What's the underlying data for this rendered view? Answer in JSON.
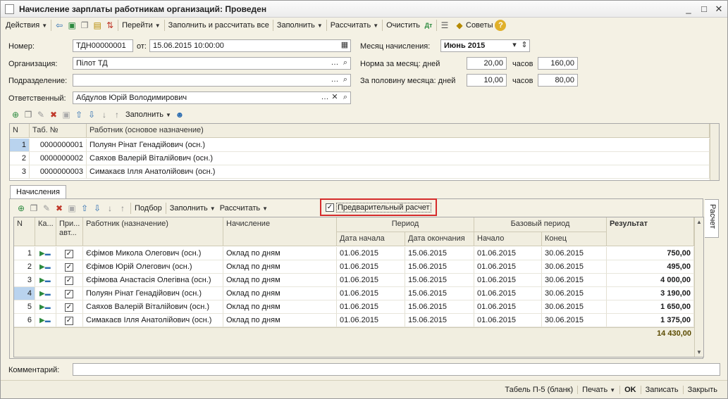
{
  "window": {
    "title": "Начисление зарплаты работникам организаций: Проведен"
  },
  "toolbar": {
    "actions": "Действия",
    "goto": "Перейти",
    "fill_calc_all": "Заполнить и рассчитать все",
    "fill": "Заполнить",
    "calculate": "Рассчитать",
    "clear": "Очистить",
    "tips": "Советы"
  },
  "form": {
    "number_label": "Номер:",
    "number_value": "ТДН00000001",
    "from_label": "от:",
    "date_value": "15.06.2015 10:00:00",
    "org_label": "Организация:",
    "org_value": "Пілот ТД",
    "dept_label": "Подразделение:",
    "dept_value": "",
    "resp_label": "Ответственный:",
    "resp_value": "Абдулов Юрій Володимирович",
    "month_label": "Месяц начисления:",
    "month_value": "Июнь 2015",
    "norm_label": "Норма за месяц: дней",
    "norm_days": "20,00",
    "hours_label": "часов",
    "norm_hours": "160,00",
    "half_label": "За половину месяца: дней",
    "half_days": "10,00",
    "half_hours": "80,00"
  },
  "workers_toolbar": {
    "fill": "Заполнить"
  },
  "workers_table": {
    "headers": [
      "N",
      "Таб. №",
      "Работник (основое назначение)"
    ],
    "rows": [
      {
        "n": "1",
        "tab": "0000000001",
        "name": "Полуян Рінат Генадійович (осн.)"
      },
      {
        "n": "2",
        "tab": "0000000002",
        "name": "Саяхов Валерій Віталійович (осн.)"
      },
      {
        "n": "3",
        "tab": "0000000003",
        "name": "Симакаєв Ілля Анатолійович (осн.)"
      }
    ]
  },
  "tabs": {
    "accruals": "Начисления",
    "side": "Расчет"
  },
  "accr_toolbar": {
    "select": "Подбор",
    "fill": "Заполнить",
    "calculate": "Рассчитать",
    "preliminary": "Предварительный расчет"
  },
  "accr_table": {
    "headers": {
      "n": "N",
      "ka": "Ка...",
      "pri": "При...",
      "avt": "авт...",
      "worker": "Работник (назначение)",
      "accrual": "Начисление",
      "period": "Период",
      "start": "Дата начала",
      "end": "Дата окончания",
      "base": "Базовый период",
      "bstart": "Начало",
      "bend": "Конец",
      "result": "Результат"
    },
    "rows": [
      {
        "n": "1",
        "worker": "Єфімов Микола Олегович (осн.)",
        "accrual": "Оклад по дням",
        "start": "01.06.2015",
        "end": "15.06.2015",
        "bstart": "01.06.2015",
        "bend": "30.06.2015",
        "result": "750,00"
      },
      {
        "n": "2",
        "worker": "Єфімов Юрій Олегович (осн.)",
        "accrual": "Оклад по дням",
        "start": "01.06.2015",
        "end": "15.06.2015",
        "bstart": "01.06.2015",
        "bend": "30.06.2015",
        "result": "495,00"
      },
      {
        "n": "3",
        "worker": "Єфімова Анастасія Олегівна (осн.)",
        "accrual": "Оклад по дням",
        "start": "01.06.2015",
        "end": "15.06.2015",
        "bstart": "01.06.2015",
        "bend": "30.06.2015",
        "result": "4 000,00"
      },
      {
        "n": "4",
        "worker": "Полуян Рінат Генадійович (осн.)",
        "accrual": "Оклад по дням",
        "start": "01.06.2015",
        "end": "15.06.2015",
        "bstart": "01.06.2015",
        "bend": "30.06.2015",
        "result": "3 190,00"
      },
      {
        "n": "5",
        "worker": "Саяхов Валерій Віталійович (осн.)",
        "accrual": "Оклад по дням",
        "start": "01.06.2015",
        "end": "15.06.2015",
        "bstart": "01.06.2015",
        "bend": "30.06.2015",
        "result": "1 650,00"
      },
      {
        "n": "6",
        "worker": "Симакаєв Ілля Анатолійович (осн.)",
        "accrual": "Оклад по дням",
        "start": "01.06.2015",
        "end": "15.06.2015",
        "bstart": "01.06.2015",
        "bend": "30.06.2015",
        "result": "1 375,00"
      }
    ],
    "total": "14 430,00"
  },
  "comment": {
    "label": "Комментарий:",
    "value": ""
  },
  "status": {
    "tabel": "Табель П-5 (бланк)",
    "print": "Печать",
    "ok": "OK",
    "save": "Записать",
    "close": "Закрыть"
  }
}
